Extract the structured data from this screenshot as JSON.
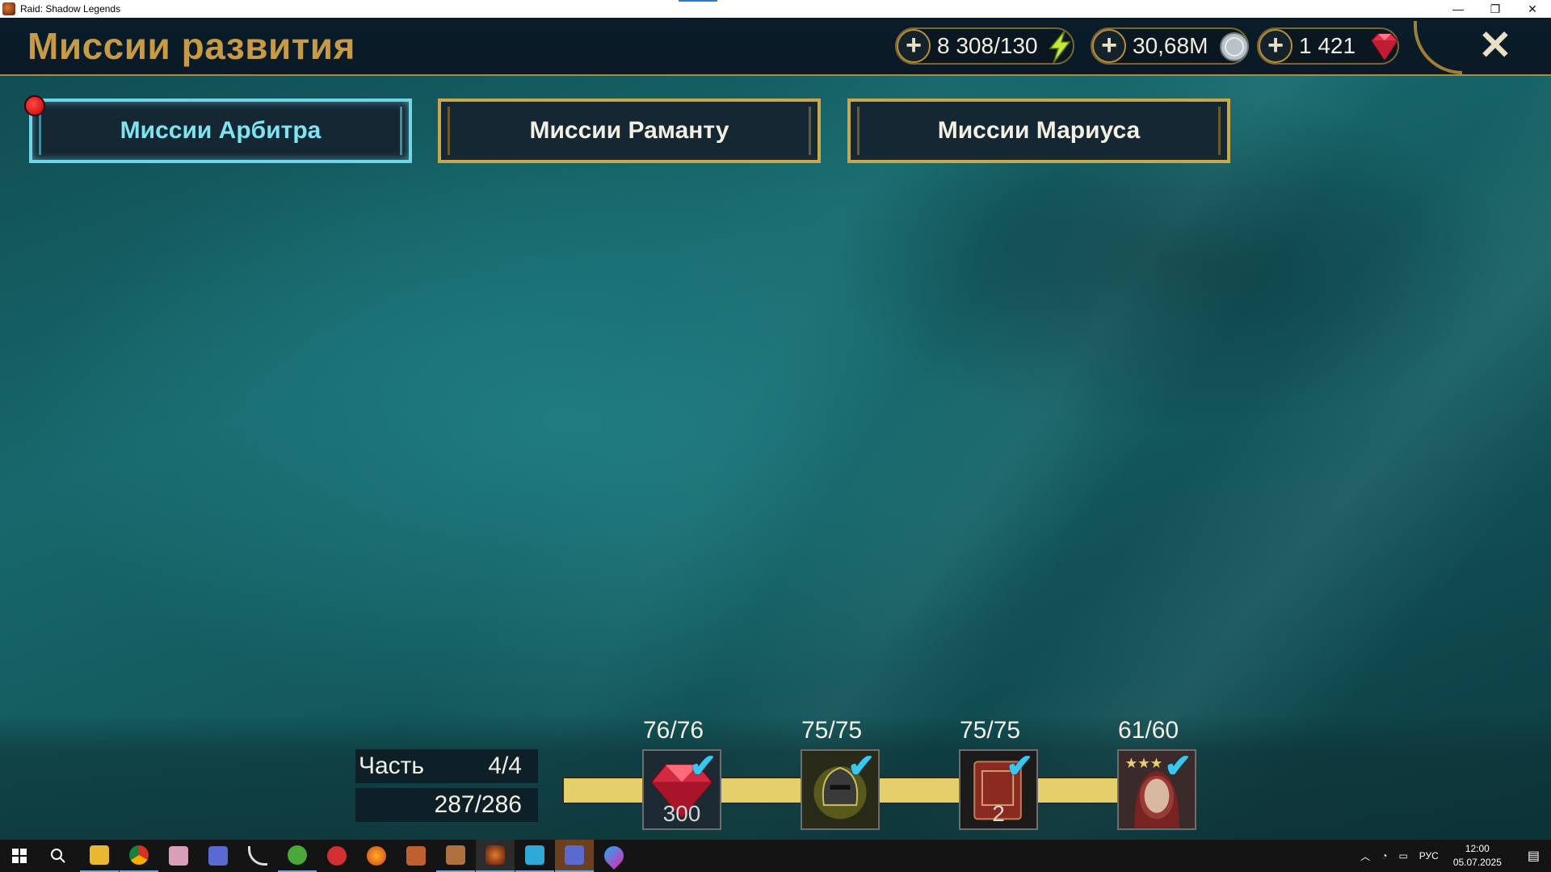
{
  "window": {
    "title": "Raid: Shadow Legends",
    "minimize": "—",
    "restore": "❐",
    "close": "✕"
  },
  "header": {
    "title": "Миссии развития",
    "resources": [
      {
        "name": "energy",
        "value": "8 308/130",
        "icon": "lightning-icon"
      },
      {
        "name": "silver",
        "value": "30,68M",
        "icon": "silver-coin-icon"
      },
      {
        "name": "gems",
        "value": "1 421",
        "icon": "ruby-gem-icon"
      }
    ],
    "close_label": "✕",
    "add_label": "+"
  },
  "tabs": [
    {
      "label": "Миссии Арбитра",
      "active": true
    },
    {
      "label": "Миссии Раманту",
      "active": false
    },
    {
      "label": "Миссии Мариуса",
      "active": false
    }
  ],
  "progress": {
    "part_label": "Часть",
    "part_value": "4/4",
    "points": "287/286",
    "rewards": [
      {
        "count": "76/76",
        "item": "ruby-gem",
        "quantity": "300",
        "claimed": true
      },
      {
        "count": "75/75",
        "item": "artifact-helmet",
        "quantity": "",
        "claimed": true
      },
      {
        "count": "75/75",
        "item": "tome-book",
        "quantity": "2",
        "claimed": true
      },
      {
        "count": "61/60",
        "item": "champion-portrait",
        "quantity": "",
        "claimed": true
      }
    ],
    "check_mark": "✔"
  },
  "taskbar": {
    "apps": [
      "start",
      "search",
      "file-explorer",
      "chrome",
      "app-pink",
      "raid-launcher",
      "app-curve",
      "utorrent",
      "app-red",
      "firefox",
      "app-bird",
      "app-bird-2",
      "raid-game",
      "app-blue",
      "raid-launcher-2",
      "app-drop"
    ],
    "tray_lang": "РУС",
    "time": "12:00",
    "date": "05.07.2025"
  },
  "colors": {
    "gold": "#c79a45",
    "active_tab": "#6fd6e8",
    "track": "#e5cf6a",
    "check": "#37c7ef"
  }
}
